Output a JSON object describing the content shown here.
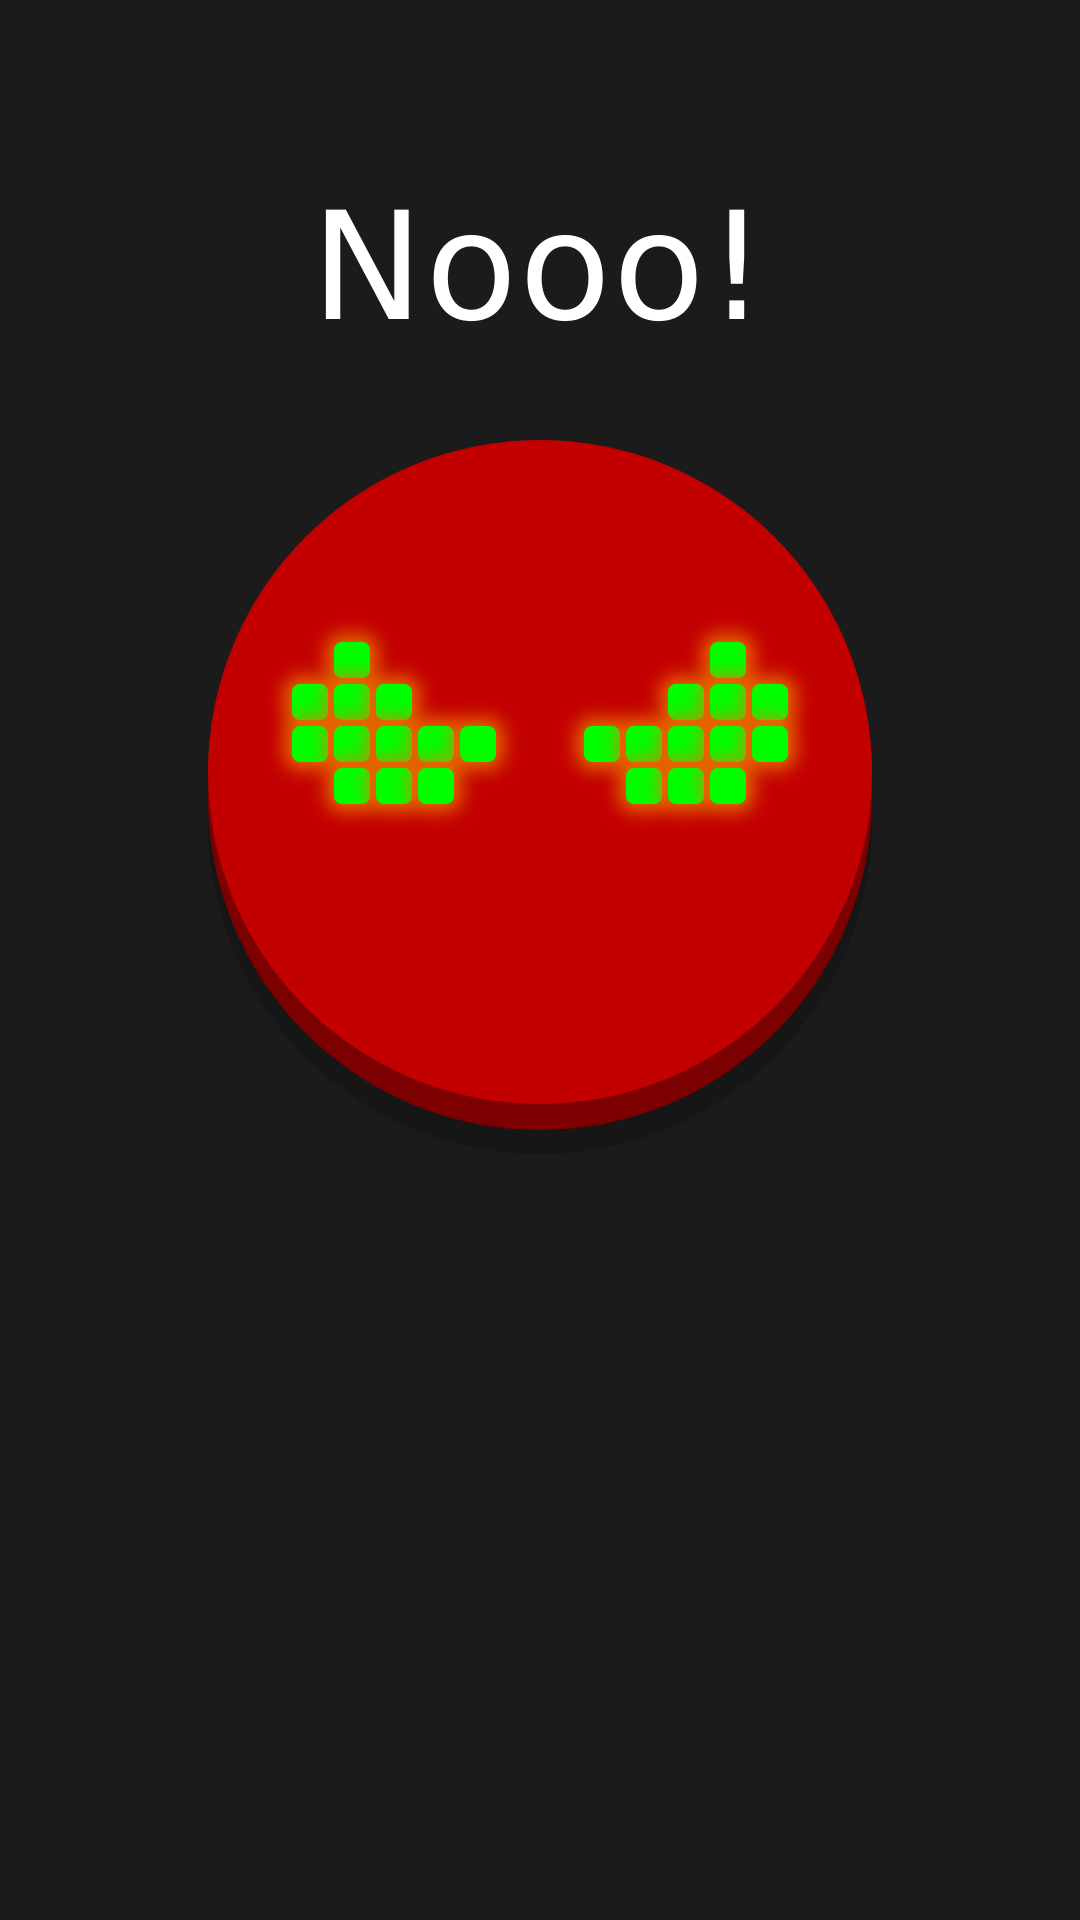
{
  "title": "Nooo!",
  "colors": {
    "background": "#1b1b1b",
    "button_face": "#c30000",
    "button_side": "#7c0000",
    "eye_pixel": "#00ff00",
    "eye_glow": "#eb7800"
  },
  "button": {
    "icon": "angry-eyes-icon"
  }
}
